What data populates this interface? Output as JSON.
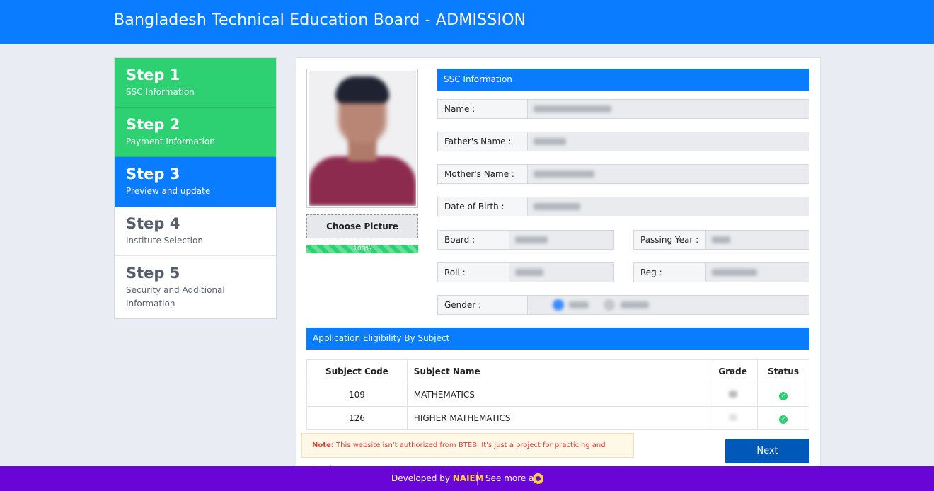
{
  "header": {
    "title": "Bangladesh Technical Education Board - ADMISSION"
  },
  "steps": [
    {
      "number": "Step 1",
      "label": "SSC Information",
      "state": "done"
    },
    {
      "number": "Step 2",
      "label": "Payment Information",
      "state": "done"
    },
    {
      "number": "Step 3",
      "label": "Preview and update",
      "state": "active"
    },
    {
      "number": "Step 4",
      "label": "Institute Selection",
      "state": "pending"
    },
    {
      "number": "Step 5",
      "label": "Security and Additional Information",
      "state": "pending"
    }
  ],
  "photo": {
    "choose_label": "Choose Picture",
    "progress_text": "100%",
    "progress_value": 100
  },
  "ssc": {
    "heading": "SSC Information",
    "name_label": "Name :",
    "father_label": "Father's Name :",
    "mother_label": "Mother's Name :",
    "dob_label": "Date of Birth :",
    "board_label": "Board :",
    "passing_year_label": "Passing Year :",
    "roll_label": "Roll :",
    "reg_label": "Reg :",
    "gender_label": "Gender :"
  },
  "eligibility": {
    "heading": "Application Eligibility By Subject",
    "columns": [
      "Subject Code",
      "Subject Name",
      "Grade",
      "Status"
    ],
    "rows": [
      {
        "code": "109",
        "name": "MATHEMATICS"
      },
      {
        "code": "126",
        "name": "HIGHER MATHEMATICS"
      }
    ]
  },
  "note": {
    "prefix": "Note:",
    "text": "This website isn't authorized from BTEB. It's just a project for practicing and learning."
  },
  "next_label": "Next",
  "footer": {
    "developed_by": "Developed by",
    "author": "NAIEM",
    "see_more": "See more at"
  },
  "colors": {
    "primary": "#0a7cff",
    "success": "#2ed171",
    "footer": "#6a05d8",
    "accent": "#ffcf3a",
    "button": "#0058b9"
  }
}
